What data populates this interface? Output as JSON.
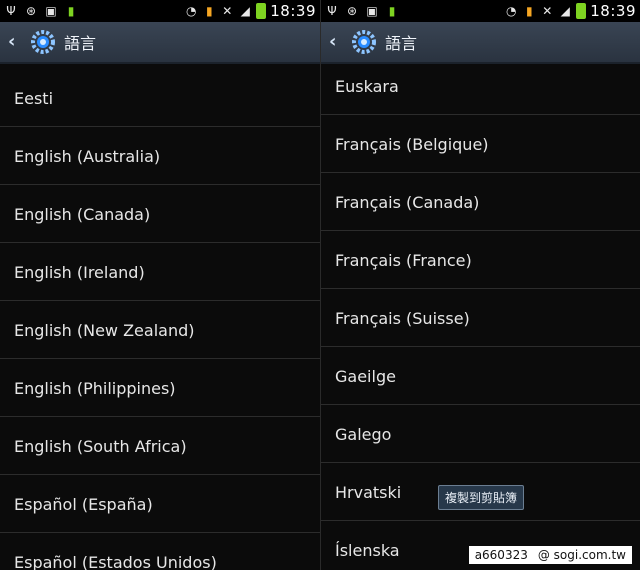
{
  "left": {
    "status": {
      "time": "18:39"
    },
    "actionbar": {
      "title": "語言"
    },
    "items": [
      {
        "label": "Eesti"
      },
      {
        "label": "English (Australia)"
      },
      {
        "label": "English (Canada)"
      },
      {
        "label": "English (Ireland)"
      },
      {
        "label": "English (New Zealand)"
      },
      {
        "label": "English (Philippines)"
      },
      {
        "label": "English (South Africa)"
      },
      {
        "label": "Español (España)"
      },
      {
        "label": "Español (Estados Unidos)"
      }
    ]
  },
  "right": {
    "status": {
      "time": "18:39"
    },
    "actionbar": {
      "title": "語言"
    },
    "items": [
      {
        "label": "Euskara"
      },
      {
        "label": "Français (Belgique)"
      },
      {
        "label": "Français (Canada)"
      },
      {
        "label": "Français (France)"
      },
      {
        "label": "Français (Suisse)"
      },
      {
        "label": "Gaeilge"
      },
      {
        "label": "Galego"
      },
      {
        "label": "Hrvatski"
      },
      {
        "label": "Íslenska"
      }
    ],
    "tooltip": "複製到剪貼簿"
  },
  "watermark": {
    "user": "a660323",
    "site": "@ sogi.com.tw"
  },
  "colors": {
    "actionbar": "#2f3947",
    "battery": "#7ed321",
    "background": "#0b0b0b"
  }
}
